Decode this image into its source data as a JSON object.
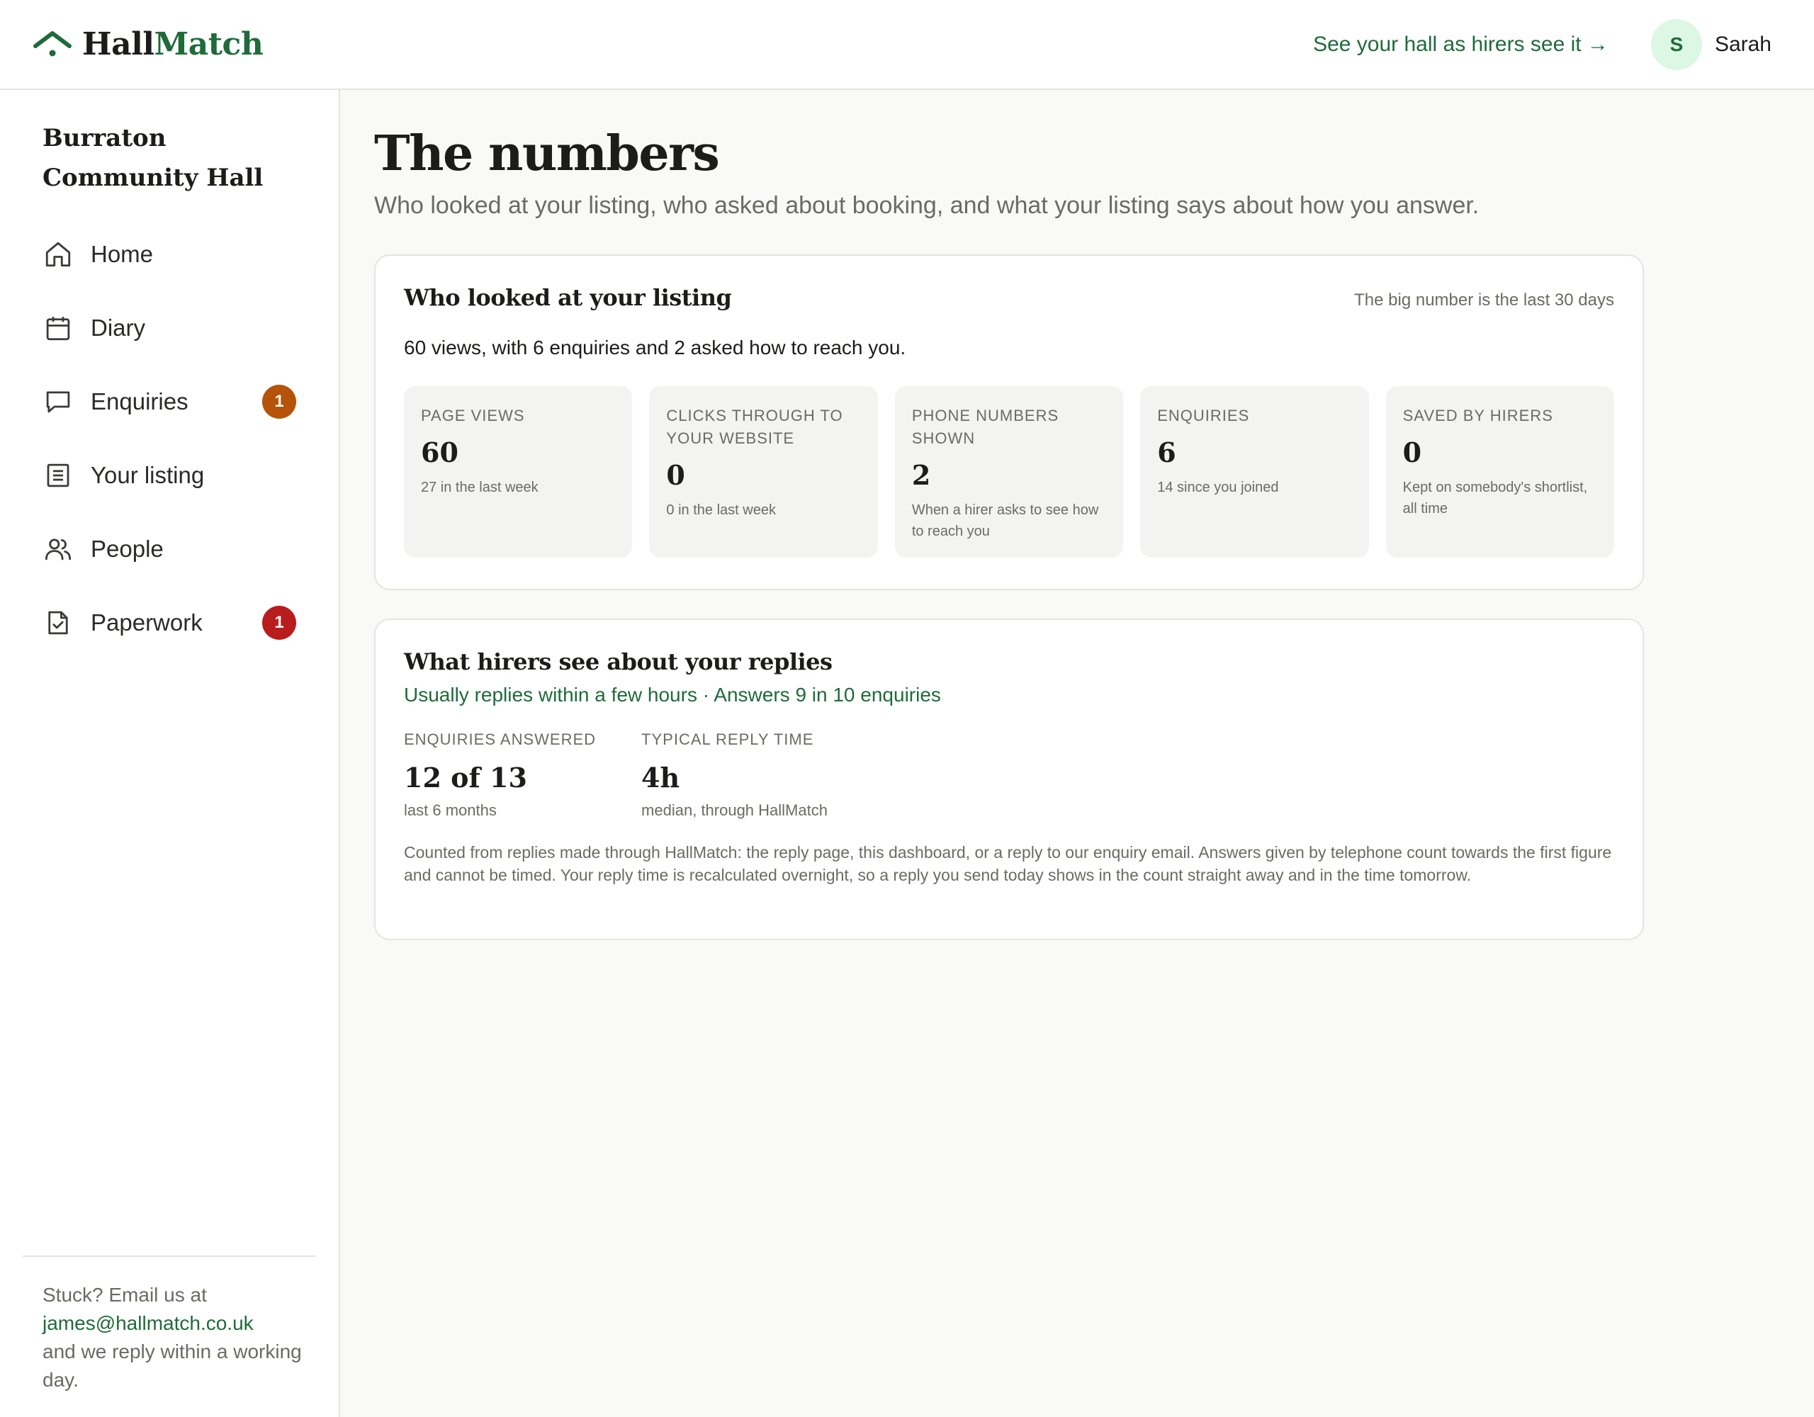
{
  "brand": {
    "part1": "Hall",
    "part2": "Match",
    "logo_icon": "roof-pin-icon",
    "color": "#1f6b3a"
  },
  "header": {
    "preview_link": "See your hall as hirers see it →",
    "avatar_initial": "S",
    "user_name": "Sarah"
  },
  "sidebar": {
    "hall_name": "Burraton Community Hall",
    "items": [
      {
        "label": "Home",
        "icon": "home-icon"
      },
      {
        "label": "Diary",
        "icon": "calendar-icon"
      },
      {
        "label": "Enquiries",
        "icon": "chat-icon",
        "badge": "1",
        "badge_color": "#b45309"
      },
      {
        "label": "Your listing",
        "icon": "list-icon"
      },
      {
        "label": "People",
        "icon": "people-icon"
      },
      {
        "label": "Paperwork",
        "icon": "checked-document-icon",
        "badge": "1",
        "badge_color": "#b91c1c"
      }
    ],
    "footer": {
      "text_before": "Stuck? Email us at",
      "email": "james@hallmatch.co.uk",
      "text_after": "and we reply within a working day."
    }
  },
  "page": {
    "title": "The numbers",
    "subtitle": "Who looked at your listing, who asked about booking, and what your listing says about how you answer."
  },
  "views_card": {
    "title": "Who looked at your listing",
    "note": "The big number is the last 30 days",
    "summary": "60 views, with 6 enquiries and 2 asked how to reach you.",
    "stats": [
      {
        "label": "Page views",
        "value": "60",
        "note": "27 in the last week"
      },
      {
        "label": "Clicks through to your website",
        "value": "0",
        "note": "0 in the last week"
      },
      {
        "label": "Phone numbers shown",
        "value": "2",
        "note": "When a hirer asks to see how to reach you"
      },
      {
        "label": "Enquiries",
        "value": "6",
        "note": "14 since you joined"
      },
      {
        "label": "Saved by hirers",
        "value": "0",
        "note": "Kept on somebody's shortlist, all time"
      }
    ]
  },
  "replies_card": {
    "title": "What hirers see about your replies",
    "tagline": "Usually replies within a few hours · Answers 9 in 10 enquiries",
    "stats": [
      {
        "label": "Enquiries answered",
        "value": "12 of 13",
        "note": "last 6 months"
      },
      {
        "label": "Typical reply time",
        "value": "4h",
        "note": "median, through HallMatch"
      }
    ],
    "explanation": "Counted from replies made through HallMatch: the reply page, this dashboard, or a reply to our enquiry email. Answers given by telephone count towards the first figure and cannot be timed. Your reply time is recalculated overnight, so a reply you send today shows in the count straight away and in the time tomorrow."
  }
}
